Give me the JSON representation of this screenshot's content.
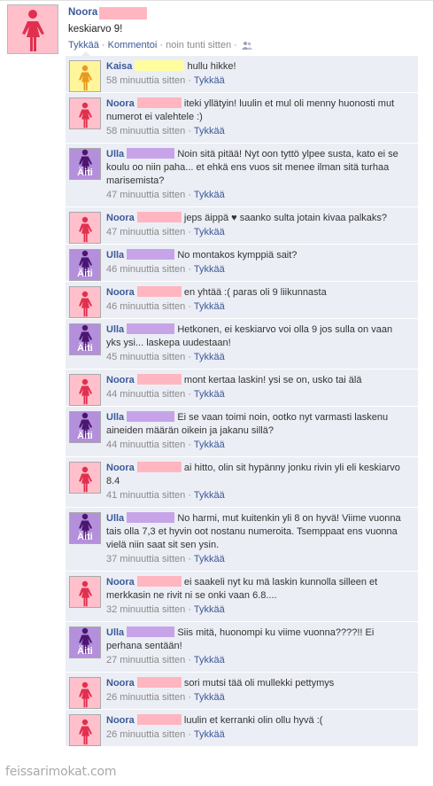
{
  "post": {
    "author": "Noora",
    "text": "keskiarvo 9!",
    "like_label": "Tykkää",
    "comment_label": "Kommentoi",
    "time": "noin tunti sitten",
    "separator": "·",
    "avatar_color": "#ffc0cb"
  },
  "colors": {
    "noora": "#ffc0cb",
    "noora_mask": "#ffb6c1",
    "ulla": "#b48fdb",
    "ulla_mask": "#c7a4e8",
    "kaisa": "#fff59a",
    "kaisa_mask": "#fffd9e",
    "link": "#3b5998"
  },
  "comments": [
    {
      "author": "Kaisa",
      "who": "kaisa",
      "text": "hullu hikke!",
      "time": "58 minuuttia sitten",
      "like": "Tykkää"
    },
    {
      "author": "Noora",
      "who": "noora",
      "text": "iteki yllätyin! luulin et mul oli menny huonosti mut numerot ei valehtele :)",
      "time": "58 minuuttia sitten",
      "like": "Tykkää"
    },
    {
      "author": "Ulla",
      "who": "ulla",
      "badge": "Äiti",
      "text": "Noin sitä pitää! Nyt oon tyttö ylpee susta, kato ei se koulu oo niin paha... et ehkä ens vuos sit menee ilman sitä turhaa marisemista?",
      "time": "47 minuuttia sitten",
      "like": "Tykkää"
    },
    {
      "author": "Noora",
      "who": "noora",
      "text": "jeps äippä ♥ saanko sulta jotain kivaa palkaks?",
      "time": "47 minuuttia sitten",
      "like": "Tykkää"
    },
    {
      "author": "Ulla",
      "who": "ulla",
      "badge": "Äiti",
      "text": "No montakos kymppiä sait?",
      "time": "46 minuuttia sitten",
      "like": "Tykkää"
    },
    {
      "author": "Noora",
      "who": "noora",
      "text": "en yhtää :( paras oli 9 liikunnasta",
      "time": "46 minuuttia sitten",
      "like": "Tykkää"
    },
    {
      "author": "Ulla",
      "who": "ulla",
      "badge": "Äiti",
      "text": "Hetkonen, ei keskiarvo voi olla 9 jos sulla on vaan yks ysi... laskepa uudestaan!",
      "time": "45 minuuttia sitten",
      "like": "Tykkää"
    },
    {
      "author": "Noora",
      "who": "noora",
      "text": "mont kertaa laskin! ysi se on, usko tai älä",
      "time": "44 minuuttia sitten",
      "like": "Tykkää"
    },
    {
      "author": "Ulla",
      "who": "ulla",
      "badge": "Äiti",
      "text": "Ei se vaan toimi noin, ootko nyt varmasti laskenu aineiden määrän oikein ja jakanu sillä?",
      "time": "44 minuuttia sitten",
      "like": "Tykkää"
    },
    {
      "author": "Noora",
      "who": "noora",
      "text": "ai hitto, olin sit hypänny jonku rivin yli eli keskiarvo 8.4",
      "time": "41 minuuttia sitten",
      "like": "Tykkää"
    },
    {
      "author": "Ulla",
      "who": "ulla",
      "badge": "Äiti",
      "text": "No harmi, mut kuitenkin yli 8 on hyvä! Viime vuonna tais olla 7,3 et hyvin oot nostanu numeroita. Tsemppaat ens vuonna vielä niin saat sit sen ysin.",
      "time": "37 minuuttia sitten",
      "like": "Tykkää"
    },
    {
      "author": "Noora",
      "who": "noora",
      "text": "ei saakeli nyt ku mä laskin kunnolla silleen et merkkasin ne rivit ni se onki vaan 6.8....",
      "time": "32 minuuttia sitten",
      "like": "Tykkää"
    },
    {
      "author": "Ulla",
      "who": "ulla",
      "badge": "Äiti",
      "text": "Siis mitä, huonompi ku viime vuonna????!! Ei perhana sentään!",
      "time": "27 minuuttia sitten",
      "like": "Tykkää"
    },
    {
      "author": "Noora",
      "who": "noora",
      "text": "sori mutsi tää oli mullekki pettymys",
      "time": "26 minuuttia sitten",
      "like": "Tykkää"
    },
    {
      "author": "Noora",
      "who": "noora",
      "text": "luulin et kerranki olin ollu hyvä :(",
      "time": "26 minuuttia sitten",
      "like": "Tykkää"
    }
  ],
  "watermark": "feissarimokat.com"
}
